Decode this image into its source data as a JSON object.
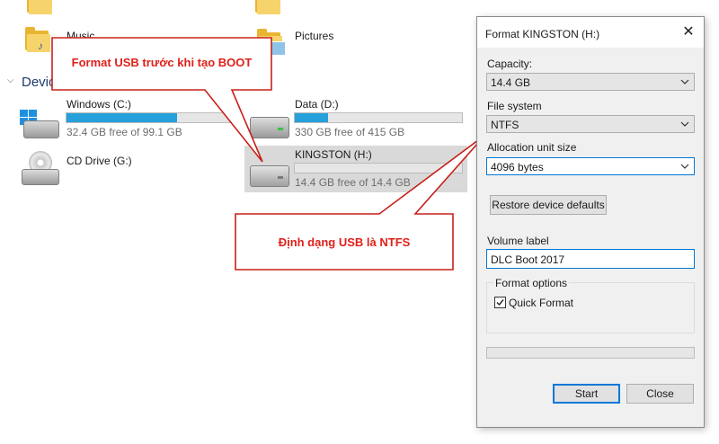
{
  "explorer": {
    "folder_music_label": "Music",
    "folder_pictures_label": "Pictures",
    "section_devices_label": "Devices and drives",
    "drives": [
      {
        "name": "Windows (C:)",
        "free_text": "32.4 GB free of 99.1 GB",
        "used_fraction": 0.67,
        "icon": "windows-drive-icon"
      },
      {
        "name": "Data (D:)",
        "free_text": "330 GB free of 415 GB",
        "used_fraction": 0.2,
        "icon": "hard-drive-icon"
      },
      {
        "name": "KINGSTON (H:)",
        "free_text": "14.4 GB free of 14.4 GB",
        "used_fraction": 0.0,
        "icon": "usb-drive-icon",
        "selected": true
      },
      {
        "name": "CD Drive (G:)",
        "icon": "cd-drive-icon"
      }
    ]
  },
  "dialog": {
    "title": "Format KINGSTON (H:)",
    "close_glyph": "✕",
    "capacity_label": "Capacity:",
    "capacity_value": "14.4 GB",
    "filesystem_label": "File system",
    "filesystem_value": "NTFS",
    "allocation_label": "Allocation unit size",
    "allocation_value": "4096 bytes",
    "restore_label": "Restore device defaults",
    "volume_label": "Volume label",
    "volume_value": "DLC Boot 2017",
    "format_options_label": "Format options",
    "quick_format_label": "Quick Format",
    "quick_format_checked": true,
    "progress": 0,
    "start_label": "Start",
    "close_label": "Close"
  },
  "callouts": {
    "top": "Format USB trước khi tạo BOOT",
    "bottom": "Định dạng USB là NTFS",
    "color": "#e0201a"
  }
}
